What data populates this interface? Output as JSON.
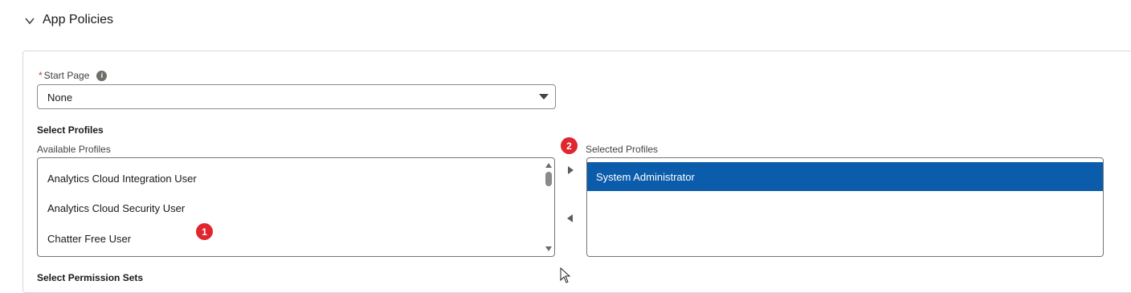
{
  "section": {
    "title": "App Policies",
    "expanded": true
  },
  "start_page": {
    "required_marker": "*",
    "label": "Start Page",
    "value": "None"
  },
  "profiles": {
    "heading": "Select Profiles",
    "available_label": "Available Profiles",
    "available": [
      "Analytics Cloud Integration User",
      "Analytics Cloud Security User",
      "Chatter Free User"
    ],
    "selected_label": "Selected Profiles",
    "selected": [
      "System Administrator"
    ]
  },
  "badges": {
    "one": "1",
    "two": "2"
  },
  "permission_sets": {
    "heading": "Select Permission Sets"
  },
  "colors": {
    "selected_bg": "#0b5cab",
    "badge": "#e0262f",
    "required": "#c23934"
  }
}
